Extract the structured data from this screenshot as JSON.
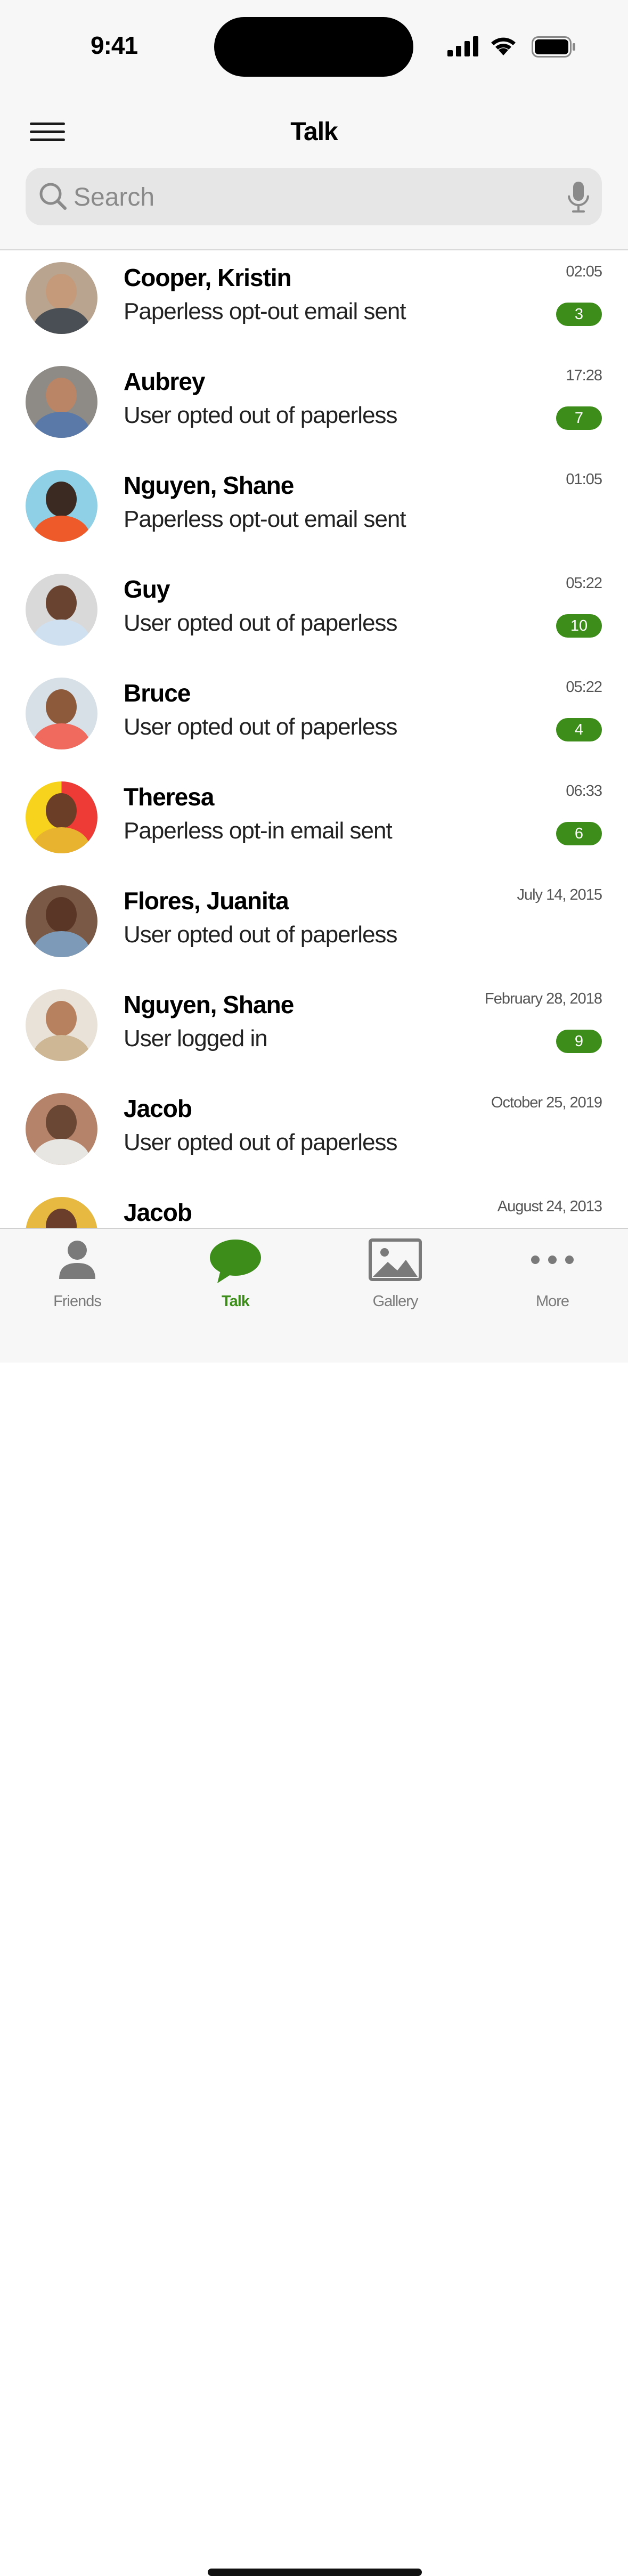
{
  "status_bar": {
    "time": "9:41"
  },
  "header": {
    "title": "Talk",
    "menu_icon": "hamburger-menu-icon"
  },
  "search": {
    "placeholder": "Search",
    "search_icon": "magnifier-icon",
    "mic_icon": "microphone-icon"
  },
  "conversations": [
    {
      "name": "Cooper, Kristin",
      "message": "Paperless opt-out email sent",
      "time": "02:05",
      "badge": "3"
    },
    {
      "name": "Aubrey",
      "message": "User opted out of paperless",
      "time": "17:28",
      "badge": "7"
    },
    {
      "name": "Nguyen, Shane",
      "message": "Paperless opt-out email sent",
      "time": "01:05",
      "badge": ""
    },
    {
      "name": "Guy",
      "message": "User opted out of paperless",
      "time": "05:22",
      "badge": "10"
    },
    {
      "name": "Bruce",
      "message": "User opted out of paperless",
      "time": "05:22",
      "badge": "4"
    },
    {
      "name": "Theresa",
      "message": "Paperless opt-in email sent",
      "time": "06:33",
      "badge": "6"
    },
    {
      "name": "Flores, Juanita",
      "message": "User opted out of paperless",
      "time": "July 14, 2015",
      "badge": ""
    },
    {
      "name": "Nguyen, Shane",
      "message": "User logged in",
      "time": "February 28, 2018",
      "badge": "9"
    },
    {
      "name": "Jacob",
      "message": "User opted out of paperless",
      "time": "October 25, 2019",
      "badge": ""
    },
    {
      "name": "Jacob",
      "message": "",
      "time": "August 24, 2013",
      "badge": ""
    }
  ],
  "tabs": [
    {
      "label": "Friends",
      "icon": "person-icon",
      "active": false
    },
    {
      "label": "Talk",
      "icon": "chat-bubble-icon",
      "active": true
    },
    {
      "label": "Gallery",
      "icon": "image-icon",
      "active": false
    },
    {
      "label": "More",
      "icon": "more-dots-icon",
      "active": false
    }
  ],
  "colors": {
    "accent": "#3d8d1a",
    "badge_text": "#ffffff",
    "header_bg": "#f7f7f7"
  }
}
